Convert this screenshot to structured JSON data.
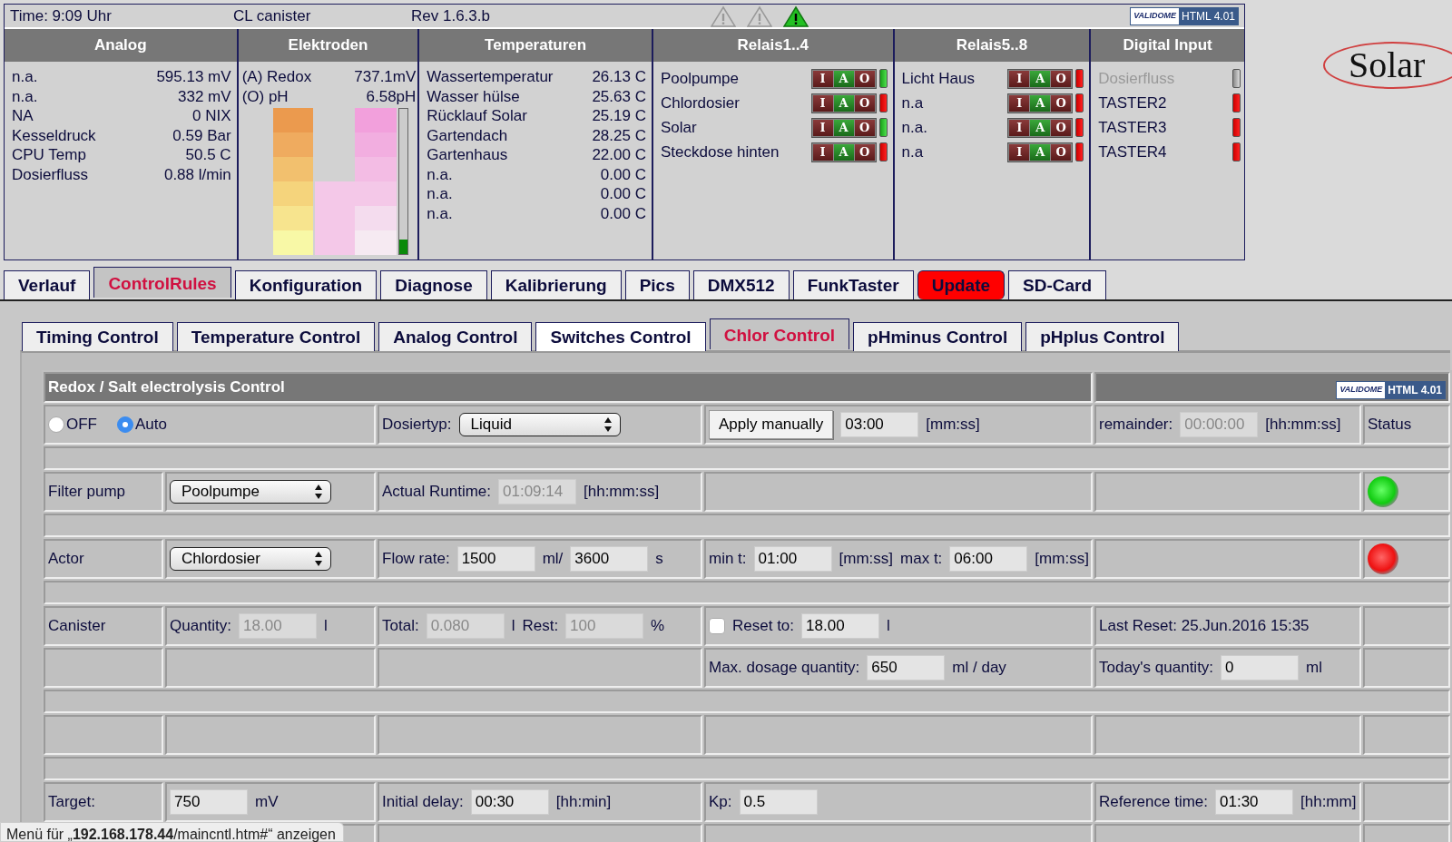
{
  "top_bar": {
    "time": "Time: 9:09 Uhr",
    "title": "CL canister",
    "revision": "Rev 1.6.3.b",
    "warnings": [
      {
        "active": false
      },
      {
        "active": false
      },
      {
        "active": true
      }
    ],
    "badge": {
      "logo": "VALIDOME",
      "label": "HTML 4.01"
    }
  },
  "logo": {
    "text": "Solar"
  },
  "panels": [
    {
      "kind": "values",
      "title": "Analog",
      "rows": [
        {
          "label": "n.a.",
          "value": "595.13 mV"
        },
        {
          "label": "n.a.",
          "value": "332 mV"
        },
        {
          "label": "NA",
          "value": "0 NIX"
        },
        {
          "label": "Kesseldruck",
          "value": "0.59 Bar"
        },
        {
          "label": "CPU Temp",
          "value": "50.5 C"
        },
        {
          "label": "Dosierfluss",
          "value": "0.88 l/min"
        }
      ]
    },
    {
      "kind": "electrodes",
      "title": "Elektroden",
      "rows": [
        {
          "label": "(A) Redox",
          "value": "737.1mV"
        },
        {
          "label": "(O) pH",
          "value": "6.58pH"
        }
      ],
      "gauge": {
        "level": 0.1
      }
    },
    {
      "kind": "values",
      "title": "Temperaturen",
      "rows": [
        {
          "label": "Wassertemperatur",
          "value": "26.13 C"
        },
        {
          "label": "Wasser hülse",
          "value": "25.63 C"
        },
        {
          "label": "Rücklauf Solar",
          "value": "25.19 C"
        },
        {
          "label": "Gartendach",
          "value": "28.25 C"
        },
        {
          "label": "Gartenhaus",
          "value": "22.00 C"
        },
        {
          "label": "n.a.",
          "value": "0.00 C"
        },
        {
          "label": "n.a.",
          "value": "0.00 C"
        },
        {
          "label": "n.a.",
          "value": "0.00 C"
        }
      ]
    },
    {
      "kind": "relays",
      "title": "Relais1..4",
      "rows": [
        {
          "name": "Poolpumpe",
          "on": true,
          "modes": [
            {
              "label": "I",
              "selected": false
            },
            {
              "label": "A",
              "selected": true
            },
            {
              "label": "O",
              "selected": false
            }
          ]
        },
        {
          "name": "Chlordosier",
          "on": false,
          "modes": [
            {
              "label": "I",
              "selected": false
            },
            {
              "label": "A",
              "selected": true
            },
            {
              "label": "O",
              "selected": false
            }
          ]
        },
        {
          "name": "Solar",
          "on": true,
          "modes": [
            {
              "label": "I",
              "selected": false
            },
            {
              "label": "A",
              "selected": true
            },
            {
              "label": "O",
              "selected": false
            }
          ]
        },
        {
          "name": "Steckdose hinten",
          "on": false,
          "modes": [
            {
              "label": "I",
              "selected": false
            },
            {
              "label": "A",
              "selected": true
            },
            {
              "label": "O",
              "selected": false
            }
          ]
        }
      ]
    },
    {
      "kind": "relays",
      "title": "Relais5..8",
      "rows": [
        {
          "name": "Licht Haus",
          "on": false,
          "modes": [
            {
              "label": "I",
              "selected": false
            },
            {
              "label": "A",
              "selected": true
            },
            {
              "label": "O",
              "selected": false
            }
          ]
        },
        {
          "name": "n.a",
          "on": false,
          "modes": [
            {
              "label": "I",
              "selected": false
            },
            {
              "label": "A",
              "selected": true
            },
            {
              "label": "O",
              "selected": false
            }
          ]
        },
        {
          "name": "n.a.",
          "on": false,
          "modes": [
            {
              "label": "I",
              "selected": false
            },
            {
              "label": "A",
              "selected": true
            },
            {
              "label": "O",
              "selected": false
            }
          ]
        },
        {
          "name": "n.a",
          "on": false,
          "modes": [
            {
              "label": "I",
              "selected": false
            },
            {
              "label": "A",
              "selected": true
            },
            {
              "label": "O",
              "selected": false
            }
          ]
        }
      ]
    },
    {
      "kind": "inputs",
      "title": "Digital Input",
      "rows": [
        {
          "name": "Dosierfluss",
          "disabled": true
        },
        {
          "name": "TASTER2",
          "disabled": false,
          "on": false
        },
        {
          "name": "TASTER3",
          "disabled": false,
          "on": false
        },
        {
          "name": "TASTER4",
          "disabled": false,
          "on": false
        }
      ]
    }
  ],
  "tabs": [
    {
      "label": "Verlauf",
      "selected": false,
      "alert": false
    },
    {
      "label": "ControlRules",
      "selected": true,
      "alert": false
    },
    {
      "label": "Konfiguration",
      "selected": false,
      "alert": false
    },
    {
      "label": "Diagnose",
      "selected": false,
      "alert": false
    },
    {
      "label": "Kalibrierung",
      "selected": false,
      "alert": false
    },
    {
      "label": "Pics",
      "selected": false,
      "alert": false
    },
    {
      "label": "DMX512",
      "selected": false,
      "alert": false
    },
    {
      "label": "FunkTaster",
      "selected": false,
      "alert": false
    },
    {
      "label": "Update",
      "selected": false,
      "alert": true
    },
    {
      "label": "SD-Card",
      "selected": false,
      "alert": false
    }
  ],
  "subtabs": [
    {
      "label": "Timing Control",
      "selected": false,
      "hovered": false
    },
    {
      "label": "Temperature Control",
      "selected": false,
      "hovered": false
    },
    {
      "label": "Analog Control",
      "selected": false,
      "hovered": false
    },
    {
      "label": "Switches Control",
      "selected": false,
      "hovered": true
    },
    {
      "label": "Chlor Control",
      "selected": true,
      "hovered": false
    },
    {
      "label": "pHminus Control",
      "selected": false,
      "hovered": false
    },
    {
      "label": "pHplus Control",
      "selected": false,
      "hovered": false
    }
  ],
  "control_table": {
    "title": "Redox / Salt electrolysis Control",
    "badge": {
      "logo": "VALIDOME",
      "label": "HTML 4.01"
    },
    "rows": [
      {
        "kind": "fields",
        "cells": [
          {
            "wide": true,
            "items": [
              {
                "kind": "radio",
                "label": "OFF",
                "selected": false
              },
              {
                "kind": "radio",
                "label": "Auto",
                "selected": true
              }
            ]
          },
          {
            "items": [
              {
                "kind": "text",
                "text": "Dosiertyp:"
              },
              {
                "kind": "select",
                "value": "Liquid"
              }
            ]
          },
          {
            "items": [
              {
                "kind": "button",
                "label": "Apply manually"
              },
              {
                "kind": "input",
                "value": "03:00",
                "disabled": false
              },
              {
                "kind": "text",
                "text": "[mm:ss]"
              }
            ]
          },
          {
            "items": [
              {
                "kind": "text",
                "text": "remainder:"
              },
              {
                "kind": "input",
                "value": "00:00:00",
                "disabled": true
              },
              {
                "kind": "text",
                "text": "[hh:mm:ss]"
              }
            ]
          },
          {
            "items": [
              {
                "kind": "text",
                "text": "Status"
              }
            ]
          }
        ]
      },
      {
        "kind": "spacer"
      },
      {
        "kind": "fields",
        "cells": [
          {
            "items": [
              {
                "kind": "text",
                "text": "Filter pump"
              }
            ]
          },
          {
            "items": [
              {
                "kind": "select",
                "value": "Poolpumpe"
              }
            ]
          },
          {
            "items": [
              {
                "kind": "text",
                "text": "Actual Runtime:"
              },
              {
                "kind": "input",
                "value": "01:09:14",
                "disabled": true
              },
              {
                "kind": "text",
                "text": "[hh:mm:ss]"
              }
            ]
          },
          {},
          {},
          {
            "items": [
              {
                "kind": "led",
                "on": true
              }
            ]
          }
        ]
      },
      {
        "kind": "spacer"
      },
      {
        "kind": "fields",
        "cells": [
          {
            "items": [
              {
                "kind": "text",
                "text": "Actor"
              }
            ]
          },
          {
            "items": [
              {
                "kind": "select",
                "value": "Chlordosier"
              }
            ]
          },
          {
            "items": [
              {
                "kind": "text",
                "text": "Flow rate:"
              },
              {
                "kind": "input",
                "value": "1500",
                "disabled": false
              },
              {
                "kind": "text",
                "text": "ml/"
              },
              {
                "kind": "input",
                "value": "3600",
                "disabled": false
              },
              {
                "kind": "text",
                "text": "s"
              }
            ]
          },
          {
            "items": [
              {
                "kind": "text",
                "text": "min t:"
              },
              {
                "kind": "input",
                "value": "01:00",
                "disabled": false
              },
              {
                "kind": "text",
                "text": "[mm:ss]"
              },
              {
                "kind": "text",
                "text": "max t:"
              },
              {
                "kind": "input",
                "value": "06:00",
                "disabled": false
              },
              {
                "kind": "text",
                "text": "[mm:ss]"
              }
            ]
          },
          {},
          {
            "items": [
              {
                "kind": "led",
                "on": false
              }
            ]
          }
        ]
      },
      {
        "kind": "spacer"
      },
      {
        "kind": "fields",
        "cells": [
          {
            "items": [
              {
                "kind": "text",
                "text": "Canister"
              }
            ]
          },
          {
            "items": [
              {
                "kind": "text",
                "text": "Quantity:"
              },
              {
                "kind": "input",
                "value": "18.00",
                "disabled": true
              },
              {
                "kind": "text",
                "text": "l"
              }
            ]
          },
          {
            "items": [
              {
                "kind": "text",
                "text": "Total:"
              },
              {
                "kind": "input",
                "value": "0.080",
                "disabled": true
              },
              {
                "kind": "text",
                "text": "l"
              },
              {
                "kind": "text",
                "text": "Rest:"
              },
              {
                "kind": "input",
                "value": "100",
                "disabled": true
              },
              {
                "kind": "text",
                "text": "%"
              }
            ]
          },
          {
            "items": [
              {
                "kind": "checkbox",
                "label": "Reset to:",
                "checked": false
              },
              {
                "kind": "input",
                "value": "18.00",
                "disabled": false
              },
              {
                "kind": "text",
                "text": "l"
              }
            ]
          },
          {
            "items": [
              {
                "kind": "text",
                "text": "Last Reset: 25.Jun.2016 15:35"
              }
            ]
          },
          {}
        ]
      },
      {
        "kind": "fields",
        "cells": [
          {},
          {},
          {},
          {
            "items": [
              {
                "kind": "text",
                "text": "Max. dosage quantity:"
              },
              {
                "kind": "input",
                "value": "650",
                "disabled": false
              },
              {
                "kind": "text",
                "text": "ml / day"
              }
            ]
          },
          {
            "items": [
              {
                "kind": "text",
                "text": "Today's quantity:"
              },
              {
                "kind": "input",
                "value": "0",
                "disabled": false
              },
              {
                "kind": "text",
                "text": "ml"
              }
            ]
          },
          {}
        ]
      },
      {
        "kind": "spacer"
      },
      {
        "kind": "fields",
        "cells": [
          {},
          {},
          {},
          {},
          {},
          {}
        ]
      },
      {
        "kind": "spacer"
      },
      {
        "kind": "fields",
        "cells": [
          {
            "items": [
              {
                "kind": "text",
                "text": "Target:"
              }
            ]
          },
          {
            "items": [
              {
                "kind": "input",
                "value": "750",
                "disabled": false
              },
              {
                "kind": "text",
                "text": "mV"
              }
            ]
          },
          {
            "items": [
              {
                "kind": "text",
                "text": "Initial delay:"
              },
              {
                "kind": "input",
                "value": "00:30",
                "disabled": false
              },
              {
                "kind": "text",
                "text": "[hh:min]"
              }
            ]
          },
          {
            "items": [
              {
                "kind": "text",
                "text": "Kp:"
              },
              {
                "kind": "input",
                "value": "0.5",
                "disabled": false
              }
            ]
          },
          {
            "items": [
              {
                "kind": "text",
                "text": "Reference time:"
              },
              {
                "kind": "input",
                "value": "01:30",
                "disabled": false
              },
              {
                "kind": "text",
                "text": "[hh:mm]"
              }
            ]
          },
          {}
        ]
      },
      {
        "kind": "fields",
        "cells": [
          {},
          {},
          {},
          {},
          {},
          {}
        ]
      }
    ]
  },
  "status_bar": {
    "text": "Menü für „**192.168.178.44**/maincntl.htm#“ anzeigen"
  }
}
